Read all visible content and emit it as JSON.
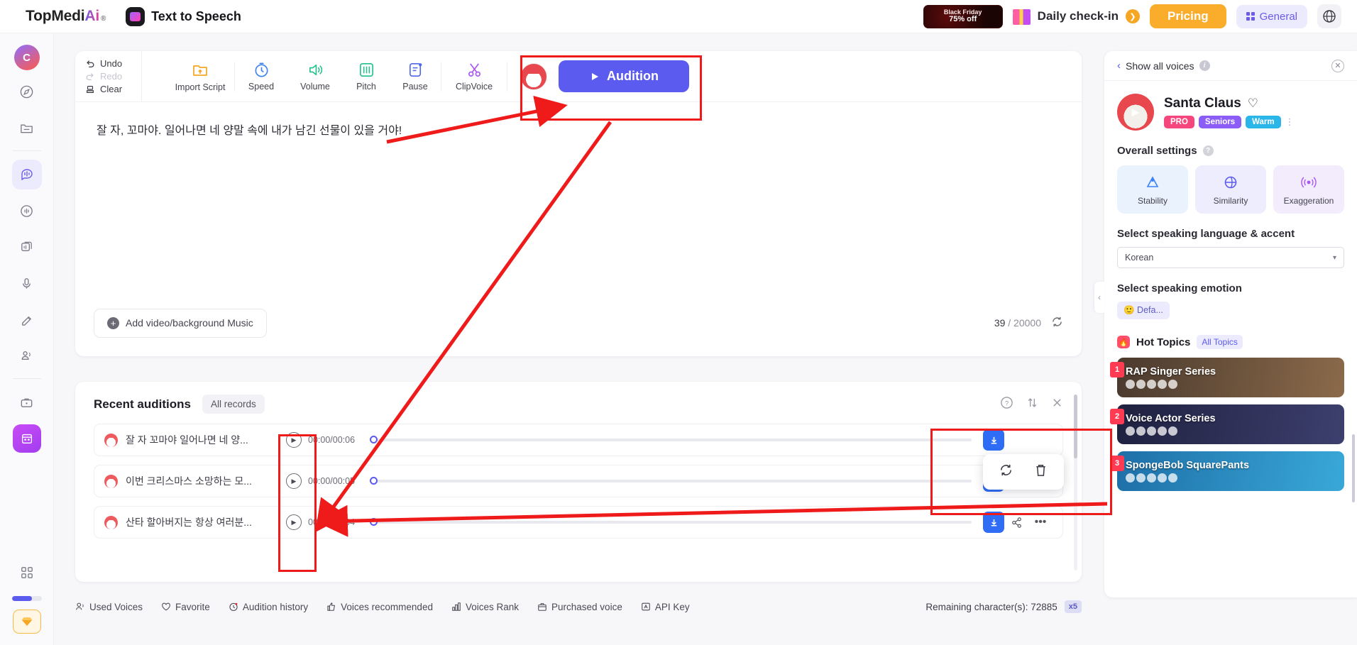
{
  "header": {
    "brand_main": "TopMedi",
    "brand_ai": "Ai",
    "brand_reg": "®",
    "app_name": "Text to Speech",
    "black_friday_line1": "Black Friday",
    "black_friday_line2": "75% off",
    "daily_checkin": "Daily check-in",
    "checkin_arrow": "❯",
    "pricing": "Pricing",
    "general": "General",
    "globe_icon": "⊕"
  },
  "rail": {
    "avatar_letter": "C",
    "items": [
      {
        "name": "explore",
        "glyph": "◔"
      },
      {
        "name": "folder",
        "glyph": "▭"
      },
      {
        "name": "text-to-speech",
        "glyph": "◑"
      },
      {
        "name": "voice-changer",
        "glyph": "◎"
      },
      {
        "name": "batch",
        "glyph": "▧"
      },
      {
        "name": "recorder",
        "glyph": "●"
      },
      {
        "name": "voice-clone",
        "glyph": "✎"
      },
      {
        "name": "speaker",
        "glyph": "△"
      },
      {
        "name": "workspace",
        "glyph": "▤"
      }
    ],
    "apps_glyph": "▦",
    "vip_glyph": "♦"
  },
  "toolbar": {
    "undo": "Undo",
    "redo": "Redo",
    "clear": "Clear",
    "import_script": "Import Script",
    "speed": "Speed",
    "volume": "Volume",
    "pitch": "Pitch",
    "pause": "Pause",
    "clipvoice": "ClipVoice",
    "audition": "Audition"
  },
  "editor": {
    "script_text": "잘 자, 꼬마야. 일어나면 네 양말 속에 내가 남긴 선물이 있을 거야!",
    "add_media": "Add video/background Music",
    "char_used": "39",
    "char_sep": "/ 20000"
  },
  "recent": {
    "title": "Recent auditions",
    "all_records": "All records",
    "rows": [
      {
        "text": "잘 자 꼬마야 일어나면 네 양...",
        "time": "00:00/00:06"
      },
      {
        "text": "이번 크리스마스 소망하는 모...",
        "time": "00:00/00:05"
      },
      {
        "text": "산타 할아버지는 항상 여러분...",
        "time": "00:00/00:04"
      }
    ],
    "download_glyph": "↓",
    "share_glyph": "⁂",
    "more_glyph": "•••",
    "help_glyph": "?",
    "sort_glyph": "⇅",
    "close_glyph": "✕"
  },
  "popup_menu": {
    "regenerate_glyph": "⟳",
    "delete_glyph": "☒"
  },
  "statusbar": {
    "items": [
      {
        "label": "Used Voices",
        "glyph": "☺"
      },
      {
        "label": "Favorite",
        "glyph": "♡"
      },
      {
        "label": "Audition history",
        "glyph": "◴"
      },
      {
        "label": "Voices recommended",
        "glyph": "☝"
      },
      {
        "label": "Voices Rank",
        "glyph": "☰"
      },
      {
        "label": "Purchased voice",
        "glyph": "▤"
      },
      {
        "label": "API Key",
        "glyph": "Ⓐ"
      }
    ],
    "remaining_label": "Remaining character(s): 72885",
    "multiplier": "x5"
  },
  "right_panel": {
    "show_all_voices": "Show all voices",
    "close_glyph": "✕",
    "voice_name": "Santa Claus",
    "heart_glyph": "♡",
    "tags": [
      "PRO",
      "Seniors",
      "Warm"
    ],
    "overall_settings": "Overall settings",
    "settings": [
      {
        "name": "Stability",
        "glyph": "△"
      },
      {
        "name": "Similarity",
        "glyph": "◎"
      },
      {
        "name": "Exaggeration",
        "glyph": "≋"
      }
    ],
    "language_label": "Select speaking language & accent",
    "language_value": "Korean",
    "emotion_label": "Select speaking emotion",
    "emotion_value": "🙂 Defa...",
    "hot_topics": "Hot Topics",
    "all_topics": "All Topics",
    "topics": [
      {
        "rank": "1",
        "title": "RAP Singer Series",
        "color1": "#4a3a2e",
        "color2": "#8b6a4a"
      },
      {
        "rank": "2",
        "title": "Voice Actor Series",
        "color1": "#1f2140",
        "color2": "#3d3f6e"
      },
      {
        "rank": "3",
        "title": "SpongeBob SquarePants",
        "color1": "#1e6fa8",
        "color2": "#39a8d8"
      }
    ]
  },
  "colors": {
    "accent_blue": "#5b5bf0",
    "accent_orange": "#f9ad2a",
    "annotation_red": "#ef1b1b",
    "download_blue": "#2f6df6"
  }
}
